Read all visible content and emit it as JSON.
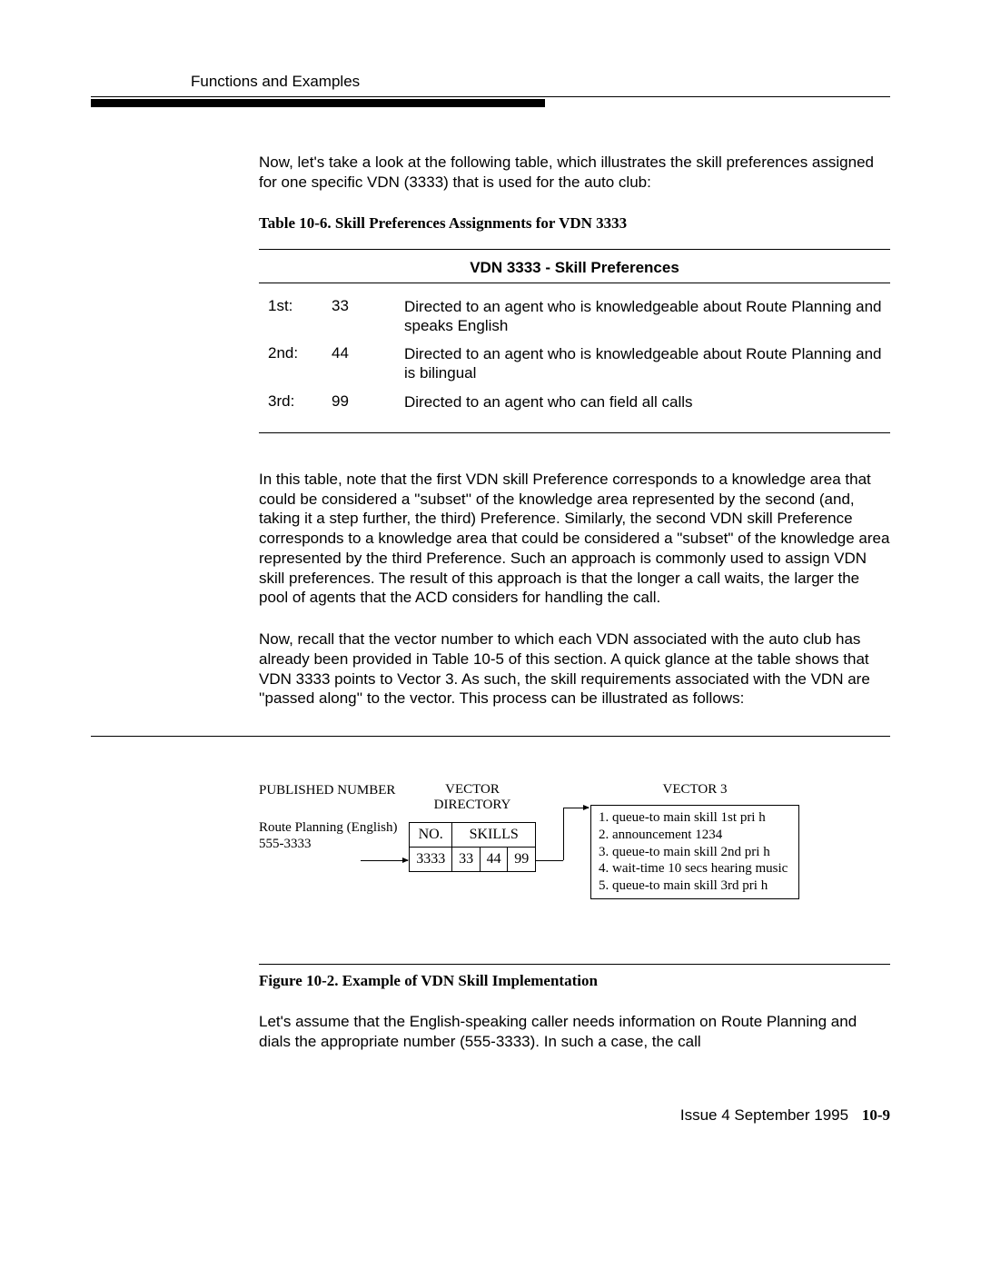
{
  "header": "Functions and Examples",
  "intro": "Now, let's take a look at the following table, which illustrates the skill preferences assigned for one specific VDN (3333) that is used for the auto club:",
  "table_caption": "Table 10-6.   Skill Preferences Assignments for VDN 3333",
  "table_title": "VDN 3333 - Skill Preferences",
  "rows": [
    {
      "pref": "1st:",
      "skill": "33",
      "desc": "Directed to an agent who is knowledgeable about Route Planning and speaks English"
    },
    {
      "pref": "2nd:",
      "skill": "44",
      "desc": "Directed to an agent who is knowledgeable about Route Planning and is bilingual"
    },
    {
      "pref": "3rd:",
      "skill": "99",
      "desc": "Directed to an agent who can field all calls"
    }
  ],
  "para2": "In this table, note that the first VDN skill Preference corresponds to a knowledge area that could be considered a ''subset'' of the knowledge area represented by the second (and, taking it a step further, the third) Preference. Similarly, the second VDN skill Preference corresponds to a knowledge area that could be considered a \"subset\" of the knowledge area represented by the third Preference. Such an approach is commonly used to assign VDN  skill preferences. The result of this approach is that the longer a call waits, the larger the pool of agents that the ACD considers for handling the call.",
  "para3": "Now, recall that the vector number to which each VDN associated with the auto club has already been provided in Table 10-5 of this section.  A quick glance at the table shows that VDN 3333 points to Vector 3.  As such, the skill requirements associated with the VDN are  ''passed along'' to the vector.  This process   can be illustrated as follows:",
  "diagram": {
    "col1_head": "PUBLISHED NUMBER",
    "col1_name": "Route Planning (English)\n555-3333",
    "col2_head": "VECTOR DIRECTORY",
    "vd_no_label": "NO.",
    "vd_skills_label": "SKILLS",
    "vd_no": "3333",
    "vd_s1": "33",
    "vd_s2": "44",
    "vd_s3": "99",
    "col3_head": "VECTOR 3",
    "steps": [
      "1. queue-to main skill 1st pri h",
      "2. announcement 1234",
      "3. queue-to main skill 2nd pri h",
      "4. wait-time 10 secs hearing music",
      "5. queue-to main skill 3rd pri h"
    ]
  },
  "figure_caption": "Figure 10-2.    Example of VDN Skill Implementation",
  "para4": "Let's assume that the English-speaking caller needs information on Route Planning and dials the appropriate number (555-3333).  In such a case, the call",
  "footer_issue": "Issue  4   September 1995",
  "footer_page": "10-9"
}
